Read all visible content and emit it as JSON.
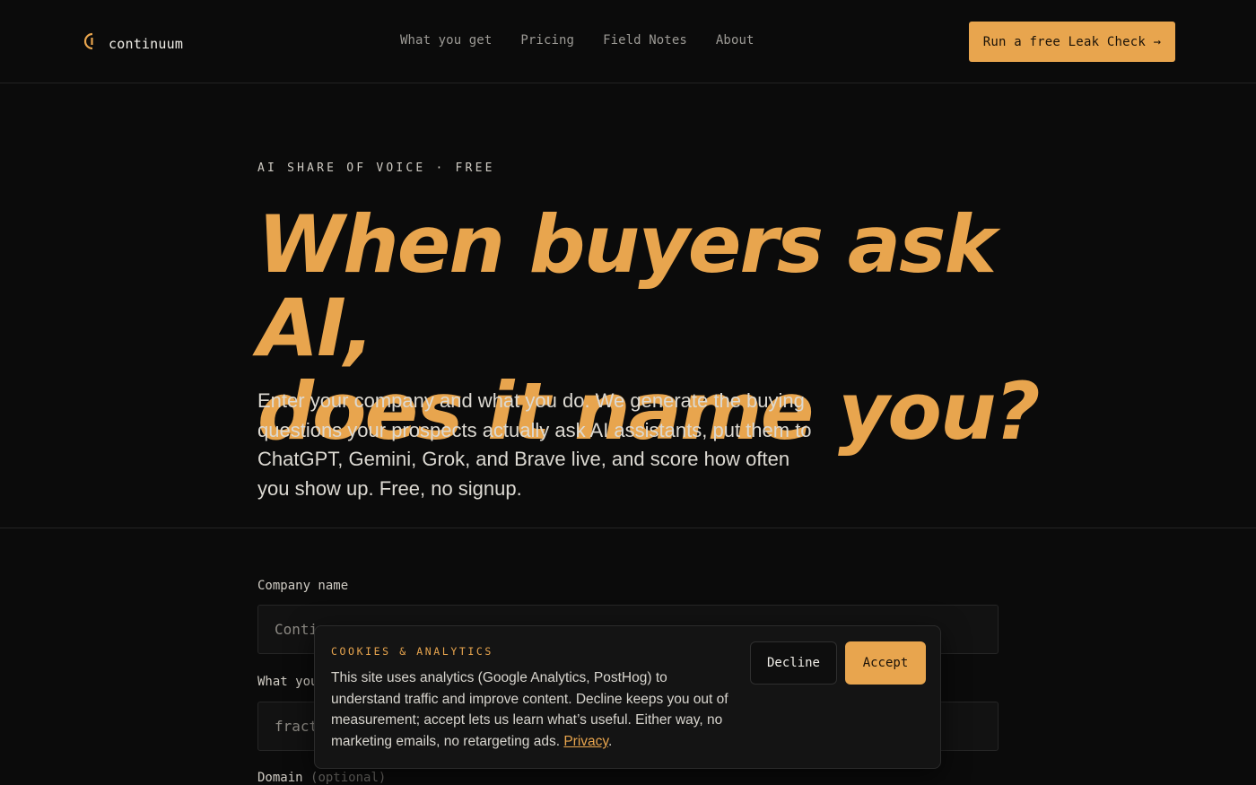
{
  "header": {
    "brand": "continuum",
    "nav": [
      "What you get",
      "Pricing",
      "Field Notes",
      "About"
    ],
    "cta_label": "Run a free Leak Check →"
  },
  "hero": {
    "eyebrow": "AI SHARE OF VOICE · FREE",
    "headline_line1": "When buyers ask AI,",
    "headline_line2": "does it name you?",
    "lead": "Enter your company and what you do. We generate the buying questions your prospects actually ask AI assistants, put them to ChatGPT, Gemini, Grok, and Brave live, and score how often you show up. Free, no signup."
  },
  "form": {
    "company_label": "Company name",
    "company_placeholder": "Contin",
    "what_label": "What you",
    "what_placeholder": "fract",
    "domain_label": "Domain",
    "domain_optional": "(optional)"
  },
  "cookie_banner": {
    "title": "COOKIES & ANALYTICS",
    "text": "This site uses analytics (Google Analytics, PostHog) to understand traffic and improve content. Decline keeps you out of measurement; accept lets us learn what’s useful. Either way, no marketing emails, no retargeting ads.",
    "privacy_link": "Privacy",
    "trailing": ".",
    "decline_label": "Decline",
    "accept_label": "Accept"
  },
  "colors": {
    "accent": "#e8a54e",
    "background": "#0b0b0b"
  }
}
